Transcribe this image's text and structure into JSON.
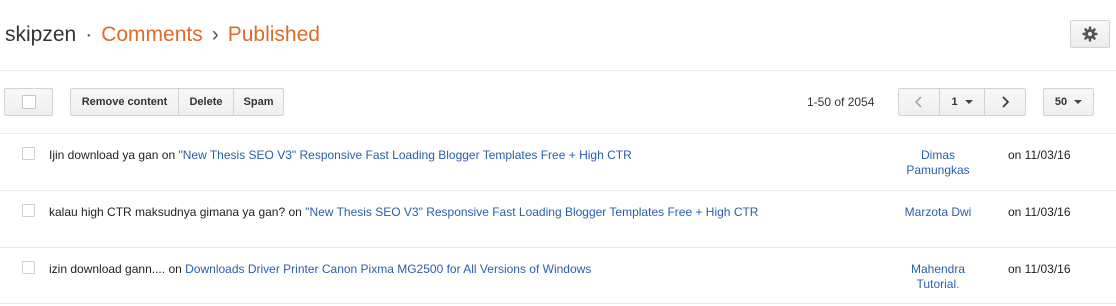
{
  "breadcrumb": {
    "blog": "skipzen",
    "sep1": "·",
    "section": "Comments",
    "sep2": "›",
    "subsection": "Published"
  },
  "toolbar": {
    "remove_label": "Remove content",
    "delete_label": "Delete",
    "spam_label": "Spam"
  },
  "pagination": {
    "range": "1-50 of 2054",
    "page": "1",
    "per_page": "50"
  },
  "comments": [
    {
      "text": "Ijin download ya gan",
      "on": "on",
      "post": "\"New Thesis SEO V3\" Responsive Fast Loading Blogger Templates Free + High CTR",
      "author": "Dimas Pamungkas",
      "date": "on 11/03/16"
    },
    {
      "text": "kalau high CTR maksudnya gimana ya gan?",
      "on": "on",
      "post": "\"New Thesis SEO V3\" Responsive Fast Loading Blogger Templates Free + High CTR",
      "author": "Marzota Dwi",
      "date": "on 11/03/16"
    },
    {
      "text": "izin download gann....",
      "on": "on",
      "post": "Downloads Driver Printer Canon Pixma MG2500 for All Versions of Windows",
      "author": "Mahendra Tutorial.",
      "date": "on 11/03/16"
    }
  ],
  "icons": {
    "settings": "gear-icon",
    "prev": "chevron-left-icon",
    "next": "chevron-right-icon",
    "dropdown": "caret-down-icon"
  },
  "colors": {
    "brand_orange": "#dd6a28",
    "link_blue": "#2a5db0"
  }
}
